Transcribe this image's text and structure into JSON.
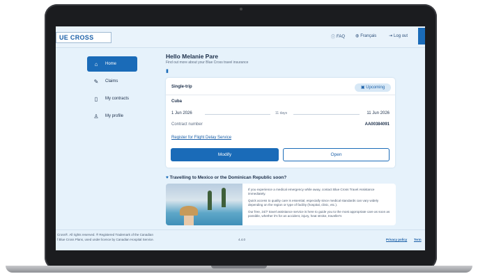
{
  "header": {
    "logo_text": "UE CROSS",
    "faq": "FAQ",
    "language": "Français",
    "logout": "Log out"
  },
  "sidebar": {
    "items": [
      {
        "label": "Home",
        "icon": "home-icon"
      },
      {
        "label": "Claims",
        "icon": "megaphone-icon"
      },
      {
        "label": "My contracts",
        "icon": "document-icon"
      },
      {
        "label": "My profile",
        "icon": "person-icon"
      }
    ]
  },
  "main": {
    "greeting": "Hello Melanie Pare",
    "subtitle": "Find out more about your Blue Cross travel insurance"
  },
  "contract": {
    "type": "Single-trip",
    "status": "Upcoming",
    "destination": "Cuba",
    "start_date": "1 Jun 2026",
    "duration": "11 days",
    "end_date": "11 Jun 2026",
    "number_label": "Contract number",
    "number_value": "AA00384091",
    "register_link": "Register for Flight Delay Service",
    "modify_label": "Modify",
    "open_label": "Open"
  },
  "promo": {
    "title": "Travelling to Mexico or the Dominican Republic soon?",
    "paragraph1": "If you experience a medical emergency while away, contact Blue Cross Travel Assistance immediately.",
    "paragraph2": "Quick access to quality care is essential, especially since medical standards can vary widely depending on the region or type of facility (hospital, clinic, etc.).",
    "paragraph3": "Our free, 24/7 travel assistance service is here to guide you to the most appropriate care as soon as possible, whether it's for an accident, injury, heat stroke, traveller's"
  },
  "footer": {
    "line1": "Cross®. All rights reserved. ® Registered Trademark of the Canadian",
    "line2": "f Blue Cross Plans, used under licence by Canadian Hospital Service.",
    "version": "4.4.0",
    "privacy": "Privacy policy",
    "terms": "Term"
  },
  "colors": {
    "accent": "#1a6bb8",
    "background": "#e6f2fb"
  }
}
